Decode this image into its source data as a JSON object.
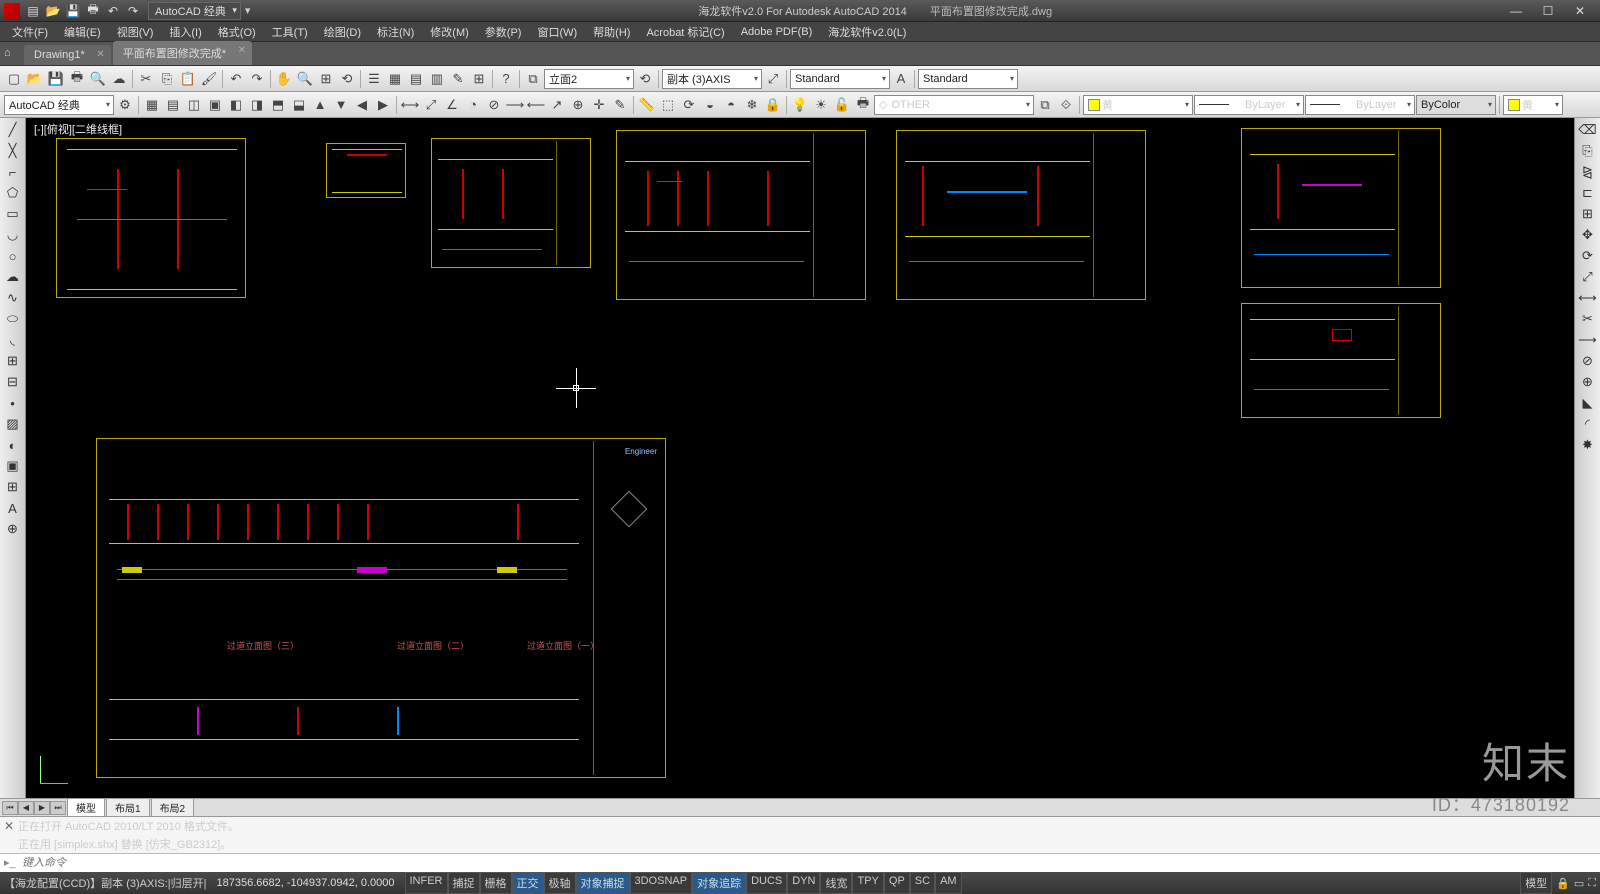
{
  "title": {
    "app_hint": "海龙软件v2.0 For Autodesk AutoCAD 2014",
    "doc": "平面布置图修改完成.dwg",
    "workspace_qat": "AutoCAD 经典"
  },
  "window_buttons": {
    "min": "—",
    "max": "☐",
    "close": "✕"
  },
  "menus": [
    "文件(F)",
    "编辑(E)",
    "视图(V)",
    "插入(I)",
    "格式(O)",
    "工具(T)",
    "绘图(D)",
    "标注(N)",
    "修改(M)",
    "参数(P)",
    "窗口(W)",
    "帮助(H)",
    "Acrobat 标记(C)",
    "Adobe PDF(B)",
    "海龙软件v2.0(L)"
  ],
  "doc_tabs": [
    {
      "label": "Drawing1*",
      "active": false
    },
    {
      "label": "平面布置图修改完成*",
      "active": true
    }
  ],
  "toolbar1": {
    "workspace": "AutoCAD 经典",
    "layer_dd": "立面2",
    "dim_style": "副本 (3)AXIS",
    "text_style1": "Standard",
    "text_style2": "Standard"
  },
  "toolbar2": {
    "layer_filter": "OTHER",
    "color": "黄",
    "linetype": "ByLayer",
    "lineweight": "ByLayer",
    "plotstyle": "ByColor",
    "color2": "黄"
  },
  "viewport_label": "[-][俯视][二维线框]",
  "drawing_labels": {
    "a": "过道立面图（三）",
    "b": "过道立面图（二）",
    "c": "过道立面图（一）",
    "tb": "Engineer"
  },
  "model_tabs": [
    "模型",
    "布局1",
    "布局2"
  ],
  "cmd_lines": [
    "正在打开 AutoCAD 2010/LT 2010 格式文件。",
    "正在用 [simplex.shx] 替换 [仿宋_GB2312]。"
  ],
  "cmd_placeholder": "键入命令",
  "status": {
    "left": "【海龙配置(CCD)】副本 (3)AXIS:|归层开|",
    "coords": "187356.6682, -104937.0942, 0.0000",
    "toggles": [
      "INFER",
      "捕捉",
      "栅格",
      "正交",
      "极轴",
      "对象捕捉",
      "3DOSNAP",
      "对象追踪",
      "DUCS",
      "DYN",
      "线宽",
      "TPY",
      "QP",
      "SC",
      "AM"
    ],
    "toggles_on": [
      "正交",
      "对象捕捉",
      "对象追踪"
    ],
    "right": "模型"
  },
  "watermark": {
    "brand": "知末",
    "id": "ID：473180192"
  }
}
